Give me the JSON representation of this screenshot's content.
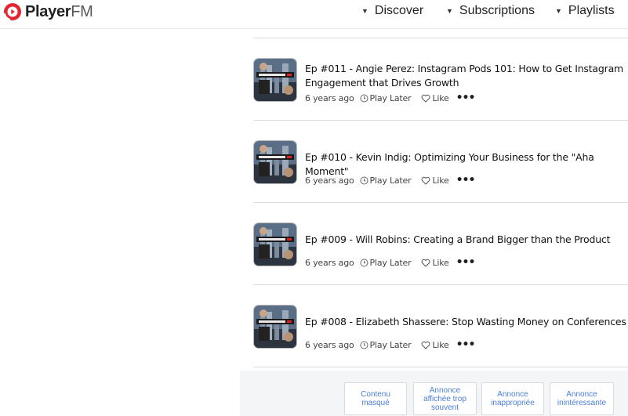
{
  "brand": {
    "name_part1": "Player",
    "name_part2": "FM",
    "accent": "#e3262f"
  },
  "nav": [
    {
      "label": "Discover"
    },
    {
      "label": "Subscriptions"
    },
    {
      "label": "Playlists"
    }
  ],
  "episodes": [
    {
      "title": "Ep #011 - Angie Perez: Instagram Pods 101: How to Get Instagram Engagement that Drives Growth",
      "age": "6 years ago",
      "play_later": "Play Later",
      "like": "Like"
    },
    {
      "title": "Ep #010 - Kevin Indig: Optimizing Your Business for the \"Aha Moment\"",
      "age": "6 years ago",
      "play_later": "Play Later",
      "like": "Like"
    },
    {
      "title": "Ep #009 - Will Robins: Creating a Brand Bigger than the Product",
      "age": "6 years ago",
      "play_later": "Play Later",
      "like": "Like"
    },
    {
      "title": "Ep #008 - Elizabeth Shassere: Stop Wasting Money on Conferences",
      "age": "6 years ago",
      "play_later": "Play Later",
      "like": "Like"
    }
  ],
  "ad_feedback": [
    {
      "label": "Contenu masqué"
    },
    {
      "label": "Annonce affichée trop souvent"
    },
    {
      "label": "Annonce inappropriée"
    },
    {
      "label": "Annonce inintéressante"
    }
  ],
  "icons": {
    "logo": "play-circle-icon",
    "caret": "caret-down-icon",
    "clock": "clock-icon",
    "heart": "heart-icon",
    "more": "more-dots-icon"
  }
}
